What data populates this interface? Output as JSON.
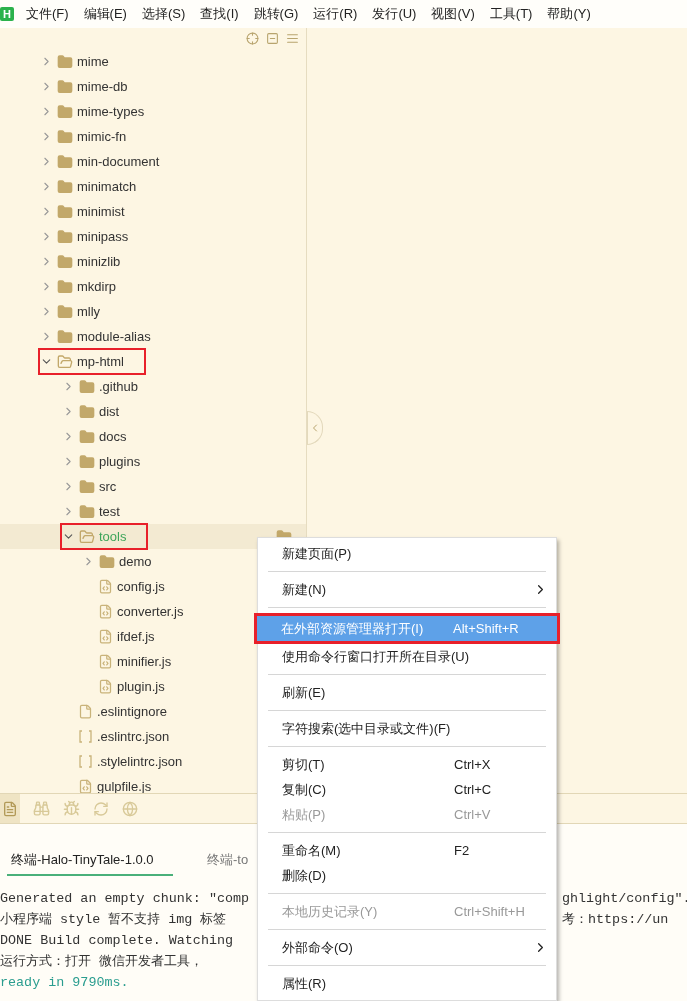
{
  "logo": "H",
  "menubar": [
    "文件(F)",
    "编辑(E)",
    "选择(S)",
    "查找(I)",
    "跳转(G)",
    "运行(R)",
    "发行(U)",
    "视图(V)",
    "工具(T)",
    "帮助(Y)"
  ],
  "tree": {
    "items": [
      {
        "label": "mime",
        "kind": "folder",
        "expanded": false,
        "selected": false
      },
      {
        "label": "mime-db",
        "kind": "folder",
        "expanded": false,
        "selected": false
      },
      {
        "label": "mime-types",
        "kind": "folder",
        "expanded": false,
        "selected": false
      },
      {
        "label": "mimic-fn",
        "kind": "folder",
        "expanded": false,
        "selected": false
      },
      {
        "label": "min-document",
        "kind": "folder",
        "expanded": false,
        "selected": false
      },
      {
        "label": "minimatch",
        "kind": "folder",
        "expanded": false,
        "selected": false
      },
      {
        "label": "minimist",
        "kind": "folder",
        "expanded": false,
        "selected": false
      },
      {
        "label": "minipass",
        "kind": "folder",
        "expanded": false,
        "selected": false
      },
      {
        "label": "minizlib",
        "kind": "folder",
        "expanded": false,
        "selected": false
      },
      {
        "label": "mkdirp",
        "kind": "folder",
        "expanded": false,
        "selected": false
      },
      {
        "label": "mlly",
        "kind": "folder",
        "expanded": false,
        "selected": false
      },
      {
        "label": "module-alias",
        "kind": "folder",
        "expanded": false,
        "selected": false
      },
      {
        "label": "mp-html",
        "kind": "folder",
        "expanded": true,
        "selected": false,
        "highlighted": true,
        "children": [
          {
            "label": ".github",
            "kind": "folder",
            "expanded": false,
            "selected": false
          },
          {
            "label": "dist",
            "kind": "folder",
            "expanded": false,
            "selected": false
          },
          {
            "label": "docs",
            "kind": "folder",
            "expanded": false,
            "selected": false
          },
          {
            "label": "plugins",
            "kind": "folder",
            "expanded": false,
            "selected": false
          },
          {
            "label": "src",
            "kind": "folder",
            "expanded": false,
            "selected": false
          },
          {
            "label": "test",
            "kind": "folder",
            "expanded": false,
            "selected": false
          },
          {
            "label": "tools",
            "kind": "folder",
            "expanded": true,
            "selected": true,
            "highlighted": true,
            "children": [
              {
                "label": "demo",
                "kind": "folder",
                "expanded": false,
                "selected": false
              },
              {
                "label": "config.js",
                "kind": "js",
                "selected": false
              },
              {
                "label": "converter.js",
                "kind": "js",
                "selected": false
              },
              {
                "label": "ifdef.js",
                "kind": "js",
                "selected": false
              },
              {
                "label": "minifier.js",
                "kind": "js",
                "selected": false
              },
              {
                "label": "plugin.js",
                "kind": "js",
                "selected": false
              }
            ]
          },
          {
            "label": ".eslintignore",
            "kind": "file",
            "selected": false
          },
          {
            "label": ".eslintrc.json",
            "kind": "json",
            "selected": false
          },
          {
            "label": ".stylelintrc.json",
            "kind": "json",
            "selected": false
          },
          {
            "label": "gulpfile.js",
            "kind": "js",
            "selected": false
          }
        ]
      }
    ]
  },
  "terminal": {
    "tabs": [
      {
        "label": "终端-Halo-TinyTale-1.0.0",
        "selected": true
      },
      {
        "label": "终端-to",
        "selected": false
      }
    ],
    "lines": [
      {
        "left": "Generated an empty chunk: \"comp",
        "right": "ghlight/config\".",
        "kind": "normal"
      },
      {
        "left": "小程序端 style 暂不支持 img 标签",
        "right": "考：https://un",
        "kind": "normal"
      },
      {
        "left": "DONE  Build complete. Watching",
        "kind": "normal"
      },
      {
        "left": "运行方式：打开 微信开发者工具，",
        "kind": "normal"
      },
      {
        "left": "ready in 9790ms.",
        "kind": "success"
      }
    ]
  },
  "menu": {
    "groups": [
      {
        "items": [
          {
            "label": "新建页面(P)",
            "selected": false,
            "disabled": false
          }
        ]
      },
      {
        "items": [
          {
            "label": "新建(N)",
            "submenu": true,
            "selected": false,
            "disabled": false
          }
        ]
      },
      {
        "items": [
          {
            "label": "在外部资源管理器打开(I)",
            "shortcut": "Alt+Shift+R",
            "selected": true,
            "disabled": false,
            "highlighted": true
          },
          {
            "label": "使用命令行窗口打开所在目录(U)",
            "selected": false,
            "disabled": false
          }
        ]
      },
      {
        "items": [
          {
            "label": "刷新(E)",
            "selected": false,
            "disabled": false
          }
        ]
      },
      {
        "items": [
          {
            "label": "字符搜索(选中目录或文件)(F)",
            "selected": false,
            "disabled": false
          }
        ]
      },
      {
        "items": [
          {
            "label": "剪切(T)",
            "shortcut": "Ctrl+X",
            "selected": false,
            "disabled": false
          },
          {
            "label": "复制(C)",
            "shortcut": "Ctrl+C",
            "selected": false,
            "disabled": false
          },
          {
            "label": "粘贴(P)",
            "shortcut": "Ctrl+V",
            "selected": false,
            "disabled": true
          }
        ]
      },
      {
        "items": [
          {
            "label": "重命名(M)",
            "shortcut": "F2",
            "selected": false,
            "disabled": false
          },
          {
            "label": "删除(D)",
            "selected": false,
            "disabled": false
          }
        ]
      },
      {
        "items": [
          {
            "label": "本地历史记录(Y)",
            "shortcut": "Ctrl+Shift+H",
            "selected": false,
            "disabled": true
          }
        ]
      },
      {
        "items": [
          {
            "label": "外部命令(O)",
            "submenu": true,
            "selected": false,
            "disabled": false
          }
        ]
      },
      {
        "items": [
          {
            "label": "属性(R)",
            "selected": false,
            "disabled": false
          }
        ]
      }
    ]
  }
}
